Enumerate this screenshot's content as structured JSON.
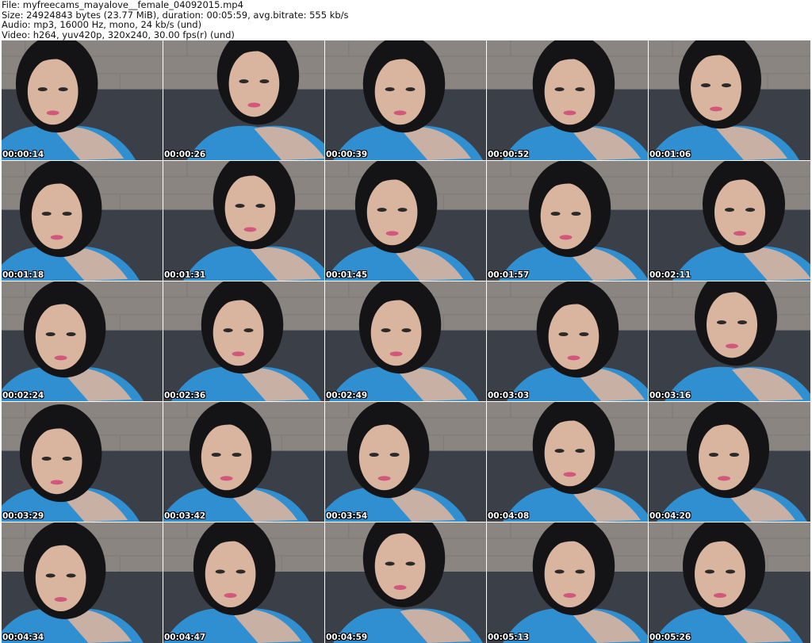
{
  "header": {
    "file_line": "File: myfreecams_mayalove__female_04092015.mp4",
    "size_line": "Size: 24924843 bytes (23.77 MiB), duration: 00:05:59, avg.bitrate: 555 kb/s",
    "audio_line": "Audio: mp3, 16000 Hz, mono, 24 kb/s (und)",
    "video_line": "Video: h264, yuv420p, 320x240, 30.00 fps(r) (und)"
  },
  "frames": [
    {
      "timestamp": "00:00:14"
    },
    {
      "timestamp": "00:00:26"
    },
    {
      "timestamp": "00:00:39"
    },
    {
      "timestamp": "00:00:52"
    },
    {
      "timestamp": "00:01:06"
    },
    {
      "timestamp": "00:01:18"
    },
    {
      "timestamp": "00:01:31"
    },
    {
      "timestamp": "00:01:45"
    },
    {
      "timestamp": "00:01:57"
    },
    {
      "timestamp": "00:02:11"
    },
    {
      "timestamp": "00:02:24"
    },
    {
      "timestamp": "00:02:36"
    },
    {
      "timestamp": "00:02:49"
    },
    {
      "timestamp": "00:03:03"
    },
    {
      "timestamp": "00:03:16"
    },
    {
      "timestamp": "00:03:29"
    },
    {
      "timestamp": "00:03:42"
    },
    {
      "timestamp": "00:03:54"
    },
    {
      "timestamp": "00:04:08"
    },
    {
      "timestamp": "00:04:20"
    },
    {
      "timestamp": "00:04:34"
    },
    {
      "timestamp": "00:04:47"
    },
    {
      "timestamp": "00:04:59"
    },
    {
      "timestamp": "00:05:13"
    },
    {
      "timestamp": "00:05:26"
    }
  ],
  "colors": {
    "background": "#ffffff",
    "wall": "#8a8580",
    "couch": "#3b3f47",
    "shirt": "#2f8fd0",
    "hair": "#141416",
    "skin": "#d9b49e",
    "timestamp_text": "#ffffff"
  }
}
